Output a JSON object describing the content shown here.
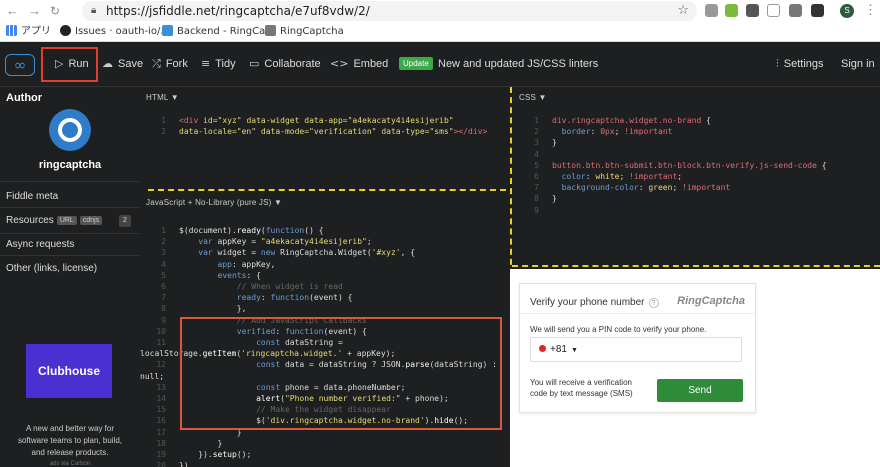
{
  "browser": {
    "url": "https://jsfiddle.net/ringcaptcha/e7uf8vdw/2/",
    "bookmarks": [
      "アプリ",
      "Issues · oauth-io/…",
      "Backend - RingCa…",
      "RingCaptcha"
    ],
    "profile": "S"
  },
  "toolbar": {
    "run": "Run",
    "save": "Save",
    "fork": "Fork",
    "tidy": "Tidy",
    "collaborate": "Collaborate",
    "embed": "Embed",
    "update_badge": "Update",
    "update_text": "New and updated JS/CSS linters",
    "settings": "Settings",
    "signin": "Sign in"
  },
  "sidebar": {
    "author_label": "Author",
    "username": "ringcaptcha",
    "fiddle_meta": "Fiddle meta",
    "resources": "Resources",
    "url_badge": "URL",
    "cdnjs_badge": "cdnjs",
    "resources_count": "2",
    "async": "Async requests",
    "other": "Other (links, license)",
    "ad_brand": "Clubhouse",
    "ad_text": [
      "A new and better way for",
      "software teams to plan, build,",
      "and release products."
    ],
    "ad_via": "ads via Carbon"
  },
  "html_panel": {
    "title": "HTML ▼"
  },
  "css_panel": {
    "title": "CSS ▼"
  },
  "js_panel": {
    "title": "JavaScript + No-Library (pure JS) ▼"
  },
  "widget": {
    "title": "Verify your phone number",
    "brand": "RingCaptcha",
    "pin_text": "We will send you a PIN code to verify your phone.",
    "country_code": "+81",
    "sms_text_1": "You will receive a verification",
    "sms_text_2": "code by text message (SMS)",
    "send": "Send"
  },
  "colors": {
    "accent": "#3a8fd8",
    "run_highlight": "#e23e2c",
    "send_button": "#2e8b37",
    "divider": "#e8d222"
  }
}
